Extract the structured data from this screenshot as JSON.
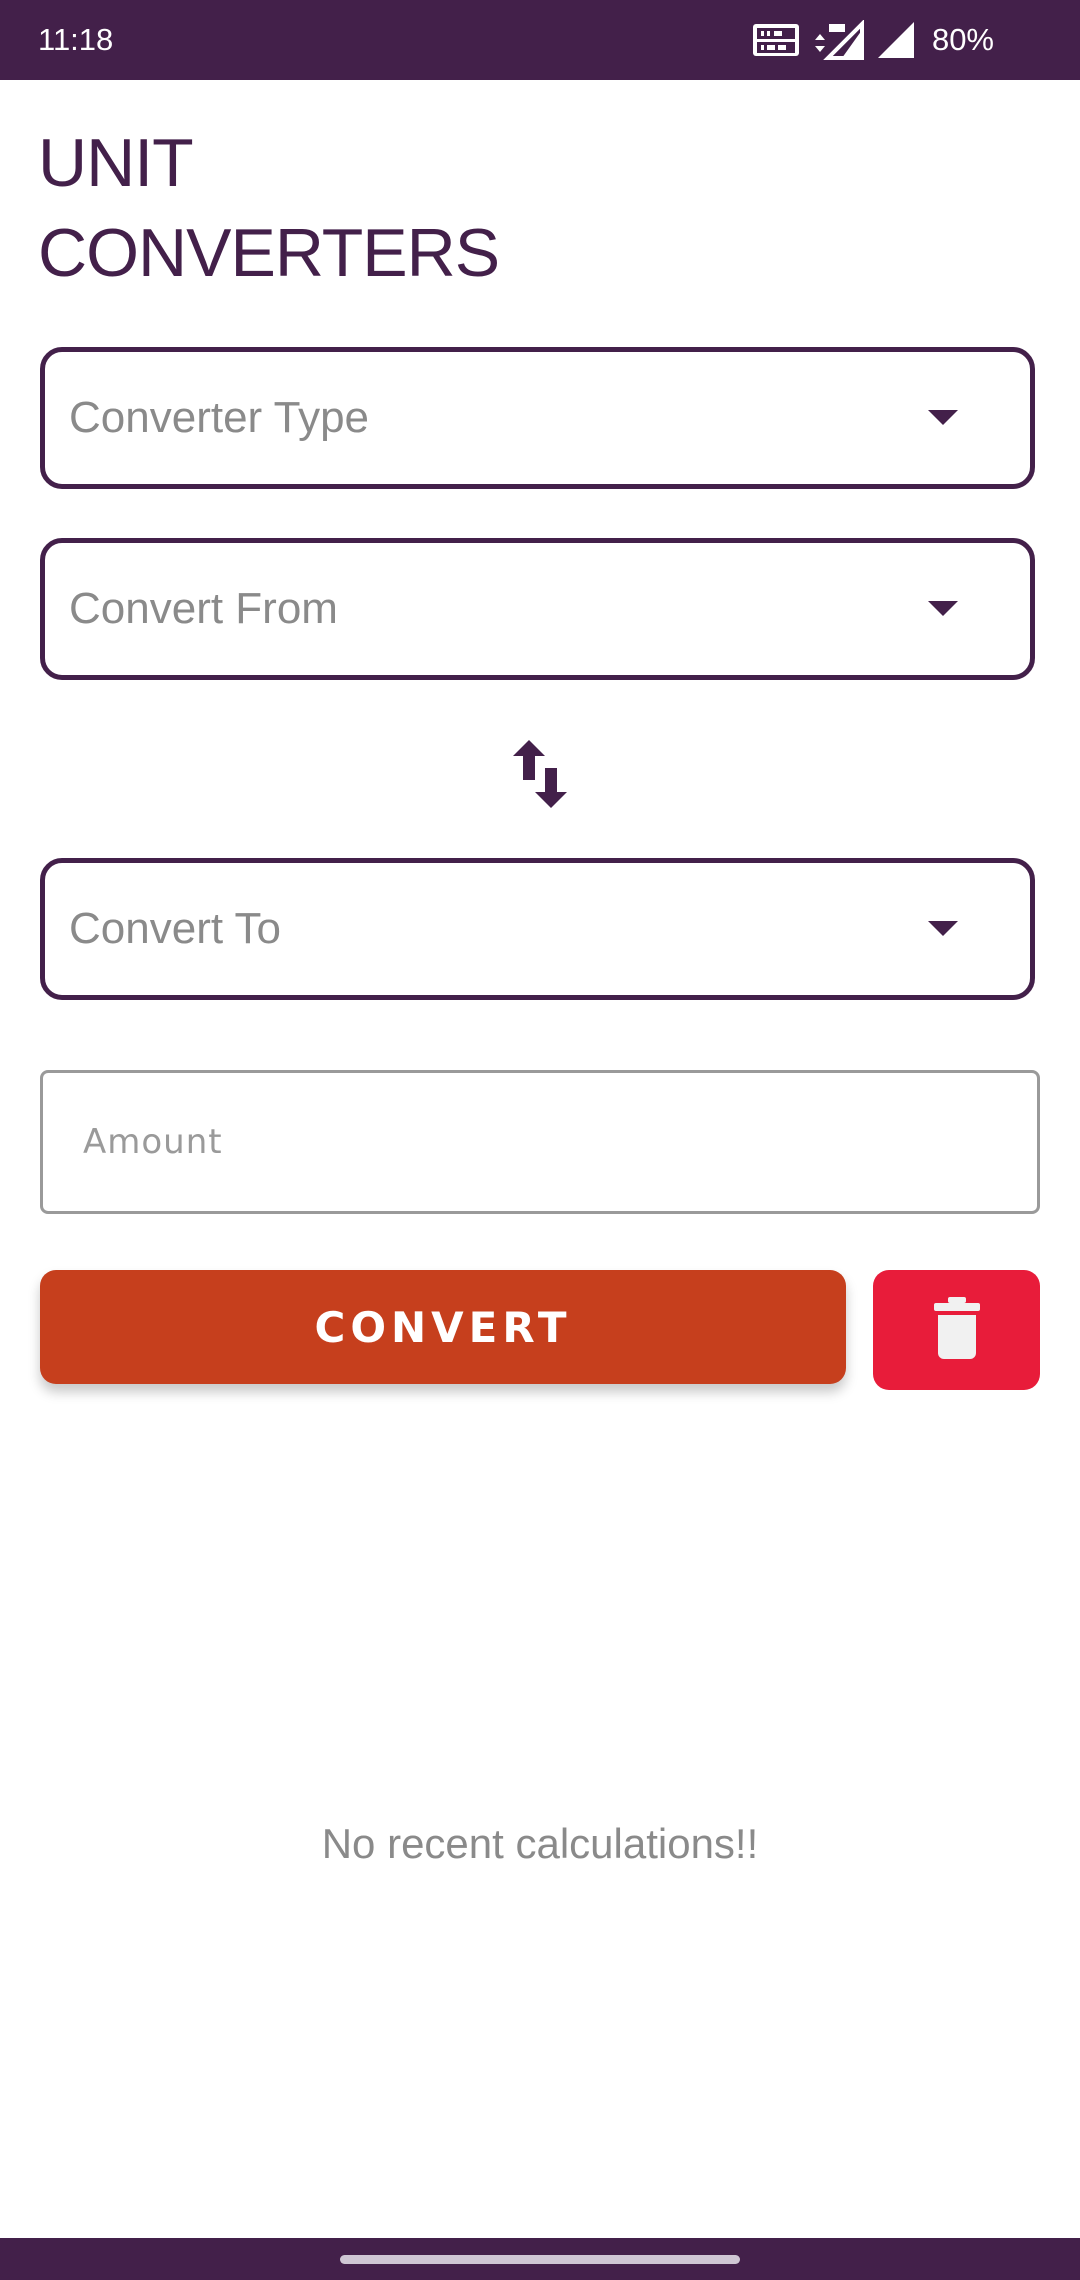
{
  "status_bar": {
    "time": "11:18",
    "battery": "80%",
    "icons": [
      "volte-icon",
      "data-4g-icon",
      "signal-icon"
    ]
  },
  "header": {
    "title_line1": "UNIT",
    "title_line2": "CONVERTERS"
  },
  "form": {
    "converter_type_placeholder": "Converter Type",
    "convert_from_placeholder": "Convert From",
    "convert_to_placeholder": "Convert To",
    "amount_placeholder": "Amount",
    "convert_label": "CONVERT",
    "swap_icon": "swap-vertical-icon",
    "delete_icon": "trash-icon"
  },
  "history": {
    "empty_message": "No recent calculations!!"
  },
  "colors": {
    "primary": "#43204a",
    "convert_button": "#c63f1d",
    "delete_button": "#e81c3a",
    "placeholder_text": "#8a8a8a"
  }
}
